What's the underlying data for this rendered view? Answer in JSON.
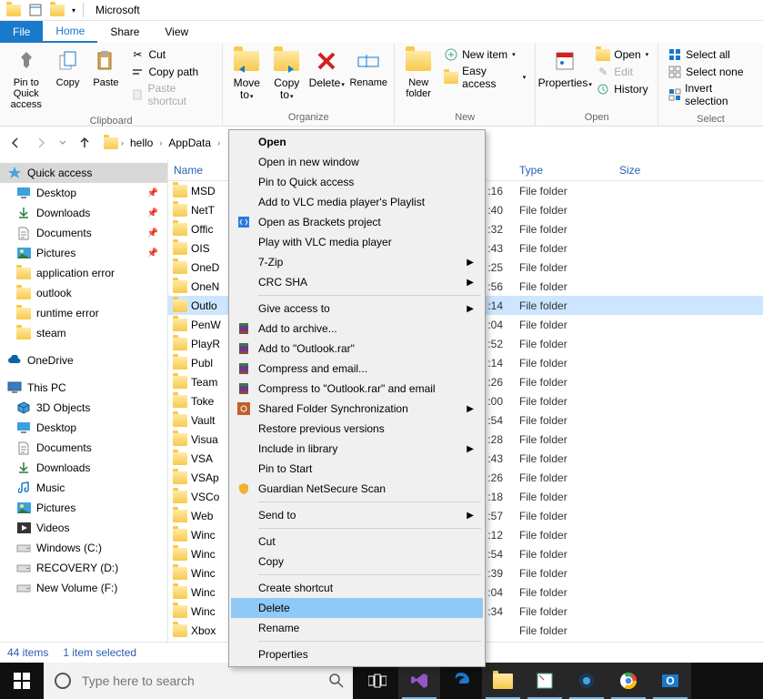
{
  "window": {
    "title": "Microsoft"
  },
  "tabs": {
    "file": "File",
    "home": "Home",
    "share": "Share",
    "view": "View"
  },
  "ribbon": {
    "clipboard": {
      "label": "Clipboard",
      "pin": "Pin to Quick access",
      "copy": "Copy",
      "paste": "Paste",
      "cut": "Cut",
      "copypath": "Copy path",
      "pasteshortcut": "Paste shortcut"
    },
    "organize": {
      "label": "Organize",
      "moveto": "Move to",
      "copyto": "Copy to",
      "delete": "Delete",
      "rename": "Rename"
    },
    "new": {
      "label": "New",
      "newfolder": "New folder",
      "newitem": "New item",
      "easyaccess": "Easy access"
    },
    "open": {
      "label": "Open",
      "properties": "Properties",
      "open": "Open",
      "edit": "Edit",
      "history": "History"
    },
    "select": {
      "label": "Select",
      "selectall": "Select all",
      "selectnone": "Select none",
      "invert": "Invert selection"
    }
  },
  "breadcrumb": [
    "hello",
    "AppData"
  ],
  "sidebar": {
    "quickaccess": "Quick access",
    "qa_items": [
      {
        "label": "Desktop",
        "pin": true,
        "icon": "desktop"
      },
      {
        "label": "Downloads",
        "pin": true,
        "icon": "downloads"
      },
      {
        "label": "Documents",
        "pin": true,
        "icon": "documents"
      },
      {
        "label": "Pictures",
        "pin": true,
        "icon": "pictures"
      },
      {
        "label": "application error",
        "pin": false,
        "icon": "folder"
      },
      {
        "label": "outlook",
        "pin": false,
        "icon": "folder"
      },
      {
        "label": "runtime error",
        "pin": false,
        "icon": "folder"
      },
      {
        "label": "steam",
        "pin": false,
        "icon": "folder"
      }
    ],
    "onedrive": "OneDrive",
    "thispc": "This PC",
    "pc_items": [
      {
        "label": "3D Objects",
        "icon": "3d"
      },
      {
        "label": "Desktop",
        "icon": "desktop"
      },
      {
        "label": "Documents",
        "icon": "documents"
      },
      {
        "label": "Downloads",
        "icon": "downloads"
      },
      {
        "label": "Music",
        "icon": "music"
      },
      {
        "label": "Pictures",
        "icon": "pictures"
      },
      {
        "label": "Videos",
        "icon": "videos"
      },
      {
        "label": "Windows (C:)",
        "icon": "drive"
      },
      {
        "label": "RECOVERY (D:)",
        "icon": "drive"
      },
      {
        "label": "New Volume (F:)",
        "icon": "drive"
      }
    ]
  },
  "columns": {
    "name": "Name",
    "date": "",
    "type": "Type",
    "size": "Size"
  },
  "files": [
    {
      "name": "MSD",
      "date": ":16",
      "type": "File folder",
      "sel": false
    },
    {
      "name": "NetT",
      "date": ":40",
      "type": "File folder",
      "sel": false
    },
    {
      "name": "Offic",
      "date": ":32",
      "type": "File folder",
      "sel": false
    },
    {
      "name": "OIS",
      "date": ":43",
      "type": "File folder",
      "sel": false
    },
    {
      "name": "OneD",
      "date": ":25",
      "type": "File folder",
      "sel": false
    },
    {
      "name": "OneN",
      "date": ":56",
      "type": "File folder",
      "sel": false
    },
    {
      "name": "Outlo",
      "date": ":14",
      "type": "File folder",
      "sel": true
    },
    {
      "name": "PenW",
      "date": ":04",
      "type": "File folder",
      "sel": false
    },
    {
      "name": "PlayR",
      "date": ":52",
      "type": "File folder",
      "sel": false
    },
    {
      "name": "Publ",
      "date": ":14",
      "type": "File folder",
      "sel": false
    },
    {
      "name": "Team",
      "date": ":26",
      "type": "File folder",
      "sel": false
    },
    {
      "name": "Toke",
      "date": ":00",
      "type": "File folder",
      "sel": false
    },
    {
      "name": "Vault",
      "date": ":54",
      "type": "File folder",
      "sel": false
    },
    {
      "name": "Visua",
      "date": ":28",
      "type": "File folder",
      "sel": false
    },
    {
      "name": "VSA",
      "date": ":43",
      "type": "File folder",
      "sel": false
    },
    {
      "name": "VSAp",
      "date": ":26",
      "type": "File folder",
      "sel": false
    },
    {
      "name": "VSCo",
      "date": ":18",
      "type": "File folder",
      "sel": false
    },
    {
      "name": "Web",
      "date": ":57",
      "type": "File folder",
      "sel": false
    },
    {
      "name": "Winc",
      "date": ":12",
      "type": "File folder",
      "sel": false
    },
    {
      "name": "Winc",
      "date": ":54",
      "type": "File folder",
      "sel": false
    },
    {
      "name": "Winc",
      "date": ":39",
      "type": "File folder",
      "sel": false
    },
    {
      "name": "Winc",
      "date": ":04",
      "type": "File folder",
      "sel": false
    },
    {
      "name": "Winc",
      "date": ":34",
      "type": "File folder",
      "sel": false
    },
    {
      "name": "Xbox",
      "date": "",
      "type": "File folder",
      "sel": false
    }
  ],
  "status": {
    "items": "44 items",
    "selected": "1 item selected"
  },
  "taskbar": {
    "search_placeholder": "Type here to search"
  },
  "contextmenu": [
    {
      "label": "Open",
      "bold": true
    },
    {
      "label": "Open in new window"
    },
    {
      "label": "Pin to Quick access"
    },
    {
      "label": "Add to VLC media player's Playlist"
    },
    {
      "label": "Open as Brackets project",
      "icon": "brackets"
    },
    {
      "label": "Play with VLC media player"
    },
    {
      "label": "7-Zip",
      "sub": true
    },
    {
      "label": "CRC SHA",
      "sub": true
    },
    {
      "sep": true
    },
    {
      "label": "Give access to",
      "sub": true
    },
    {
      "label": "Add to archive...",
      "icon": "rar"
    },
    {
      "label": "Add to \"Outlook.rar\"",
      "icon": "rar"
    },
    {
      "label": "Compress and email...",
      "icon": "rar"
    },
    {
      "label": "Compress to \"Outlook.rar\" and email",
      "icon": "rar"
    },
    {
      "label": "Shared Folder Synchronization",
      "sub": true,
      "icon": "sync"
    },
    {
      "label": "Restore previous versions"
    },
    {
      "label": "Include in library",
      "sub": true
    },
    {
      "label": "Pin to Start"
    },
    {
      "label": "Guardian NetSecure Scan",
      "icon": "shield"
    },
    {
      "sep": true
    },
    {
      "label": "Send to",
      "sub": true
    },
    {
      "sep": true
    },
    {
      "label": "Cut"
    },
    {
      "label": "Copy"
    },
    {
      "sep": true
    },
    {
      "label": "Create shortcut"
    },
    {
      "label": "Delete",
      "hovered": true
    },
    {
      "label": "Rename"
    },
    {
      "sep": true
    },
    {
      "label": "Properties"
    }
  ]
}
